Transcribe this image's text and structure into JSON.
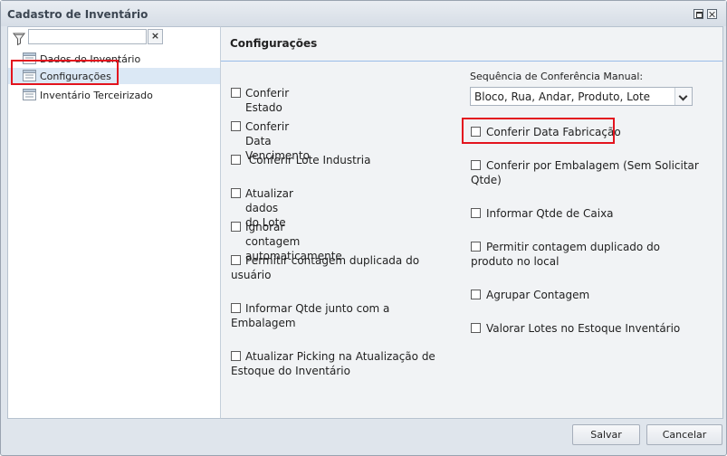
{
  "window": {
    "title": "Cadastro de Inventário"
  },
  "left": {
    "search_value": "",
    "clear_label": "×",
    "tree": [
      {
        "label": "Dados do Inventário",
        "selected": false
      },
      {
        "label": "Configurações",
        "selected": true
      },
      {
        "label": "Inventário Terceirizado",
        "selected": false
      }
    ]
  },
  "right": {
    "header": "Configurações",
    "left_options": [
      {
        "label": "Conferir Estado",
        "checked": false
      },
      {
        "label": "Conferir Data Vencimento",
        "checked": false
      },
      {
        "label": " Conferir Lote Industria",
        "checked": false
      },
      {
        "label": "Atualizar dados do Lote",
        "checked": false
      },
      {
        "label": "Ignorar contagem automaticamente",
        "checked": false
      },
      {
        "label": "Permitir contagem duplicada do",
        "label2": "usuário",
        "checked": false
      },
      {
        "label": "Informar Qtde junto com a",
        "label2": "Embalagem",
        "checked": false
      },
      {
        "label": "Atualizar Picking na Atualização de",
        "label2": "Estoque do Inventário",
        "checked": false
      }
    ],
    "sequence_label": "Sequência de Conferência Manual:",
    "sequence_value": "Bloco, Rua, Andar, Produto, Lote",
    "right_options": [
      {
        "label": "Conferir Data Fabricação",
        "checked": false
      },
      {
        "label": "Conferir por Embalagem (Sem Solicitar",
        "label2": "Qtde)",
        "checked": false
      },
      {
        "label": "Informar Qtde de Caixa",
        "checked": false
      },
      {
        "label": "Permitir contagem duplicado do",
        "label2": "produto no local",
        "checked": false
      },
      {
        "label": "Agrupar Contagem",
        "checked": false
      },
      {
        "label": "Valorar Lotes no Estoque Inventário",
        "checked": false
      }
    ]
  },
  "footer": {
    "save_label": "Salvar",
    "cancel_label": "Cancelar"
  },
  "colors": {
    "highlight": "#e3141e",
    "selection": "#dbe8f5",
    "header_line": "#99bce8"
  },
  "icons": [
    "filter-icon",
    "maximize-icon",
    "close-icon",
    "tree-node-icon"
  ]
}
